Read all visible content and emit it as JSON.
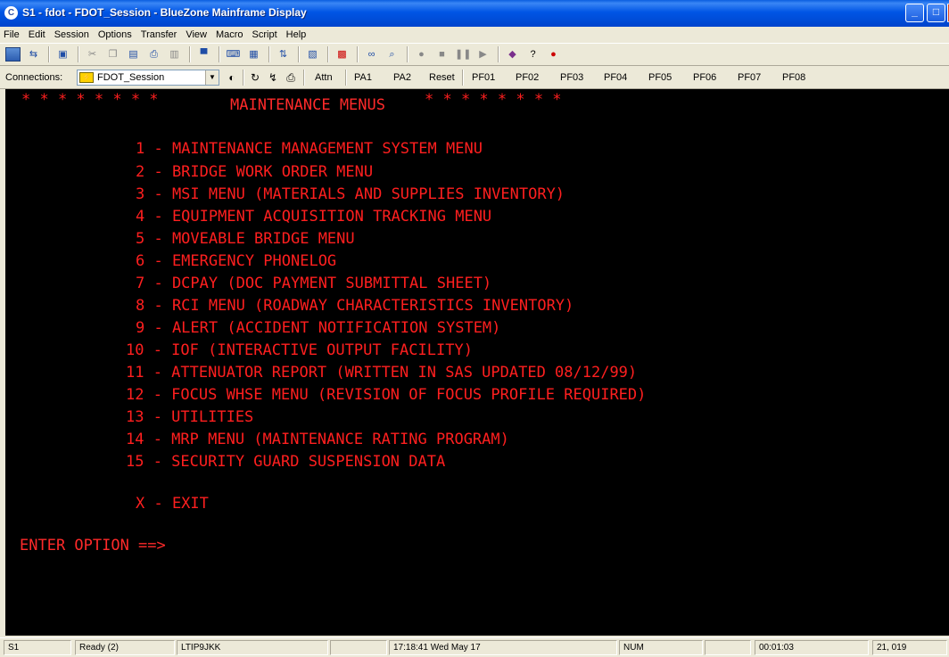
{
  "window": {
    "title": "S1 - fdot - FDOT_Session - BlueZone Mainframe Display",
    "buttons": {
      "minimize": "_",
      "maximize": "□",
      "close": ""
    }
  },
  "menubar": [
    "File",
    "Edit",
    "Session",
    "Options",
    "Transfer",
    "View",
    "Macro",
    "Script",
    "Help"
  ],
  "connection": {
    "label": "Connections:",
    "session": "FDOT_Session"
  },
  "keys": {
    "attn": "Attn",
    "pa1": "PA1",
    "pa2": "PA2",
    "reset": "Reset",
    "pf01": "PF01",
    "pf02": "PF02",
    "pf03": "PF03",
    "pf04": "PF04",
    "pf05": "PF05",
    "pf06": "PF06",
    "pf07": "PF07",
    "pf08": "PF08"
  },
  "terminal": {
    "stars_left": "* * * * * * * *",
    "header": "MAINTENANCE MENUS",
    "stars_right": "* * * * * * * *",
    "options": [
      "1 - MAINTENANCE MANAGEMENT SYSTEM MENU",
      "2 - BRIDGE WORK ORDER MENU",
      "3 - MSI MENU (MATERIALS AND SUPPLIES INVENTORY)",
      "4 - EQUIPMENT ACQUISITION TRACKING MENU",
      "5 - MOVEABLE BRIDGE MENU",
      "6 - EMERGENCY PHONELOG",
      "7 - DCPAY (DOC PAYMENT SUBMITTAL SHEET)",
      "8 - RCI MENU (ROADWAY CHARACTERISTICS INVENTORY)",
      "9 - ALERT (ACCIDENT NOTIFICATION SYSTEM)",
      "10 - IOF (INTERACTIVE OUTPUT FACILITY)",
      "11 - ATTENUATOR REPORT (WRITTEN IN SAS UPDATED 08/12/99)",
      "12 - FOCUS WHSE MENU (REVISION OF FOCUS PROFILE REQUIRED)",
      "13 - UTILITIES",
      "14 - MRP MENU (MAINTENANCE RATING PROGRAM)",
      "15 - SECURITY GUARD SUSPENSION DATA"
    ],
    "exit": "X - EXIT",
    "prompt": "ENTER OPTION ==>"
  },
  "status": {
    "session": "S1",
    "state": "Ready (2)",
    "lu": "LTIP9JKK",
    "datetime": "17:18:41  Wed May 17",
    "num": "NUM",
    "elapsed": "00:01:03",
    "cursor": "21, 019"
  },
  "colors": {
    "terminal_text": "#ff1f1f",
    "terminal_bg": "#000000",
    "titlebar": "#0055e5"
  }
}
